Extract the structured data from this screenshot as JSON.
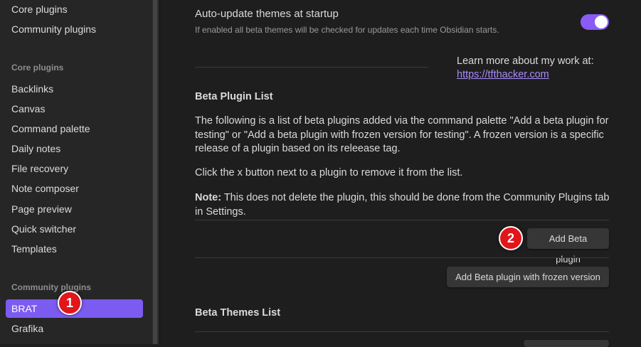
{
  "sidebar": {
    "top_items": [
      "Core plugins",
      "Community plugins"
    ],
    "core_heading": "Core plugins",
    "core_items": [
      "Backlinks",
      "Canvas",
      "Command palette",
      "Daily notes",
      "File recovery",
      "Note composer",
      "Page preview",
      "Quick switcher",
      "Templates"
    ],
    "community_heading": "Community plugins",
    "community_items": [
      "BRAT",
      "Grafika"
    ],
    "active_item": "BRAT"
  },
  "markers": [
    "1",
    "2"
  ],
  "settings": {
    "auto_update": {
      "name": "Auto-update themes at startup",
      "desc": "If enabled all beta themes will be checked for updates each time Obsidian starts.",
      "enabled": true
    },
    "learn_more": "Learn more about my work at:",
    "learn_link": "https://tfthacker.com",
    "beta_plugin_title": "Beta Plugin List",
    "beta_plugin_desc": "The following is a list of beta plugins added via the command palette \"Add a beta plugin for testing\" or \"Add a beta plugin with frozen version for testing\". A frozen version is a specific release of a plugin based on its releease tag.",
    "remove_hint": "Click the x button next to a plugin to remove it from the list.",
    "note_label": "Note:",
    "note_text": " This does not delete the plugin, this should be done from the Community Plugins tab in Settings.",
    "add_beta_button": "Add Beta plugin",
    "add_frozen_button": "Add Beta plugin with frozen version",
    "beta_themes_title": "Beta Themes List"
  },
  "colors": {
    "accent": "#7c5bf1",
    "marker": "#e0161b",
    "link": "#a88bfa"
  }
}
